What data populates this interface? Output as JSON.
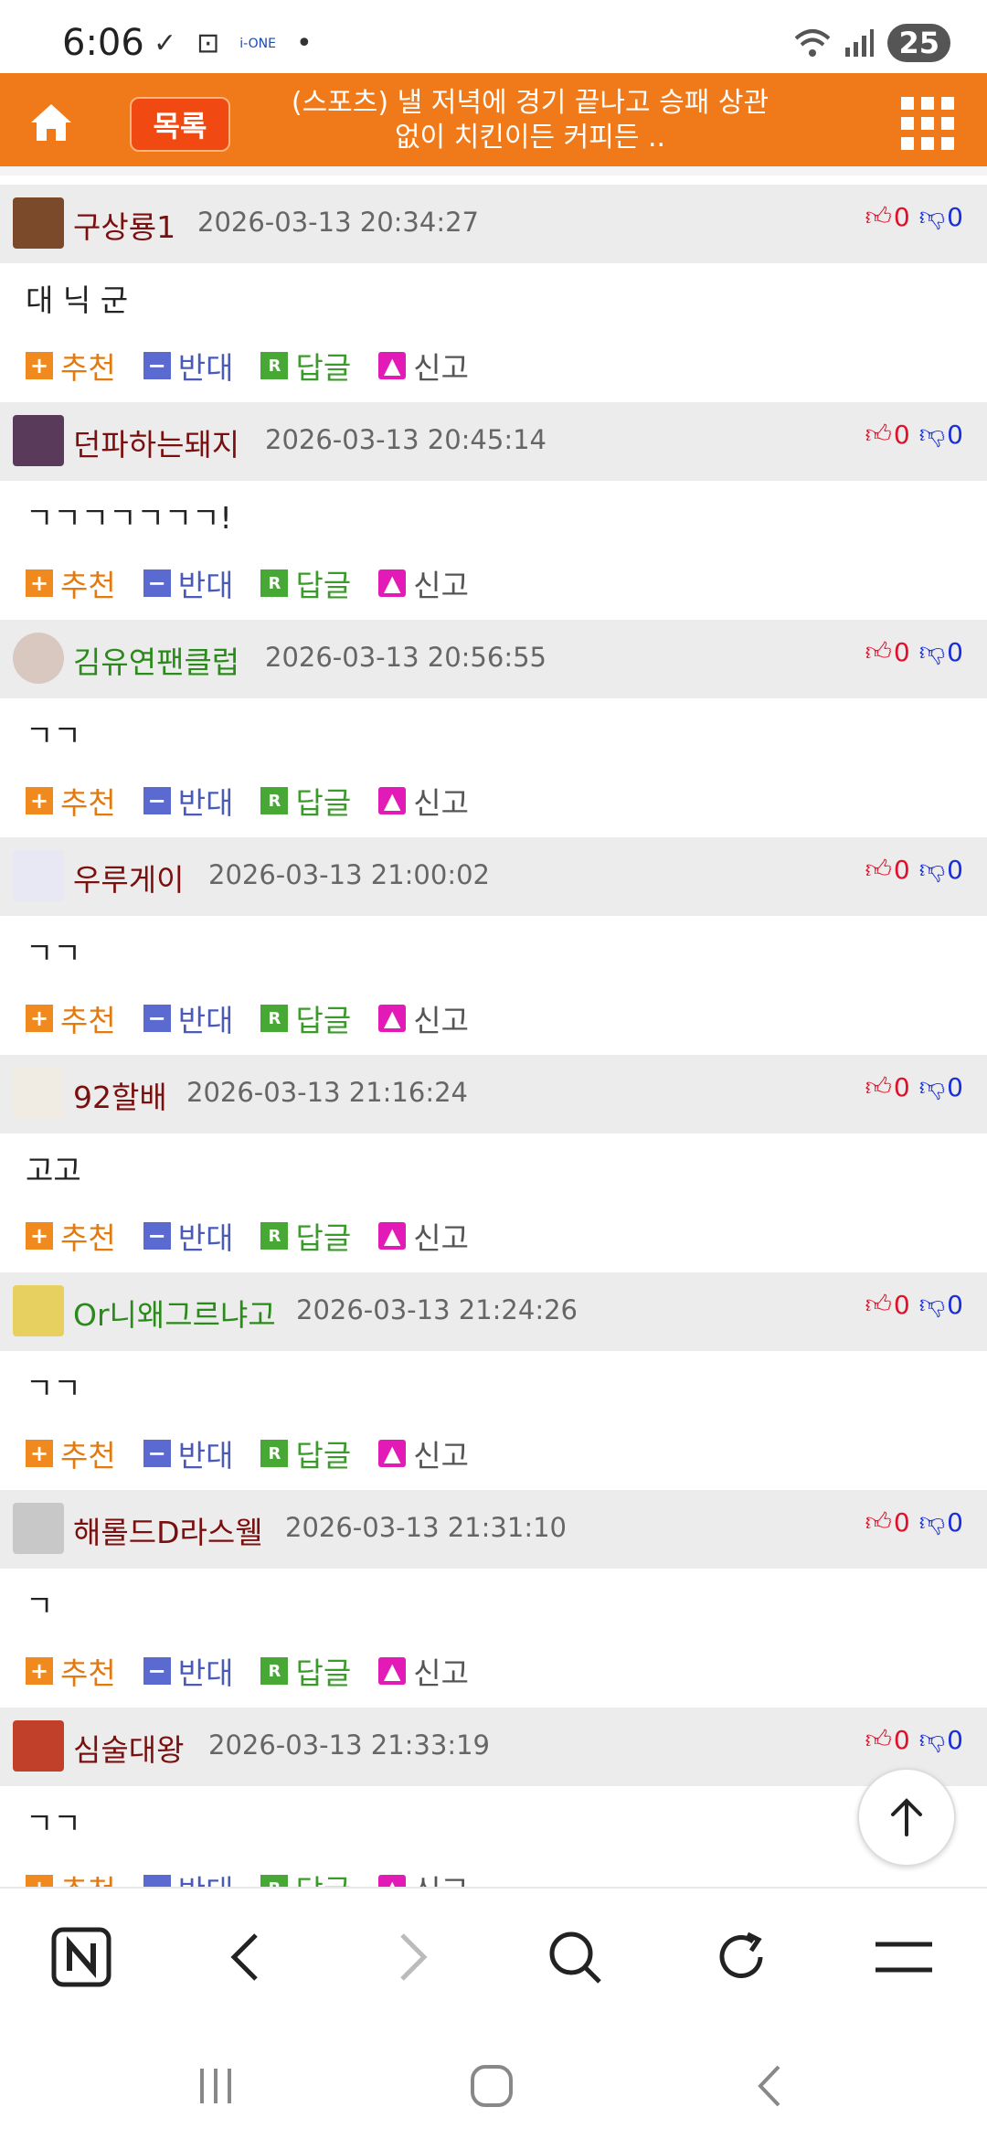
{
  "status_bar": {
    "time": "6:06",
    "battery": "25",
    "app_icon_text": "i-ONE"
  },
  "header": {
    "list_button": "목록",
    "title_line1": "(스포츠) 낼 저녁에 경기 끝나고 승패 상관",
    "title_line2": "없이 치킨이든 커피든 .."
  },
  "actions": {
    "recommend": "추천",
    "oppose": "반대",
    "reply": "답글",
    "report": "신고"
  },
  "comments": [
    {
      "user": "구상룡1",
      "time": "2026-03-13 20:34:27",
      "text": "대 닉 군",
      "up": "0",
      "down": "0"
    },
    {
      "user": "던파하는돼지",
      "time": "2026-03-13 20:45:14",
      "text": "ㄱㄱㄱㄱㄱㄱㄱ!",
      "up": "0",
      "down": "0"
    },
    {
      "user": "김유연팬클럽",
      "time": "2026-03-13 20:56:55",
      "text": "ㄱㄱ",
      "up": "0",
      "down": "0"
    },
    {
      "user": "우루게이",
      "time": "2026-03-13 21:00:02",
      "text": "ㄱㄱ",
      "up": "0",
      "down": "0"
    },
    {
      "user": "92할배",
      "time": "2026-03-13 21:16:24",
      "text": "고고",
      "up": "0",
      "down": "0"
    },
    {
      "user": "Or니왜그르냐고",
      "time": "2026-03-13 21:24:26",
      "text": "ㄱㄱ",
      "up": "0",
      "down": "0"
    },
    {
      "user": "해롤드D라스웰",
      "time": "2026-03-13 21:31:10",
      "text": "ㄱ",
      "up": "0",
      "down": "0"
    },
    {
      "user": "심술대왕",
      "time": "2026-03-13 21:33:19",
      "text": "ㄱㄱ",
      "up": "0",
      "down": "0"
    }
  ],
  "colors": {
    "brand": "#f07a1a",
    "username": "#7a0f0f",
    "username_green": "#2a8a1a"
  }
}
